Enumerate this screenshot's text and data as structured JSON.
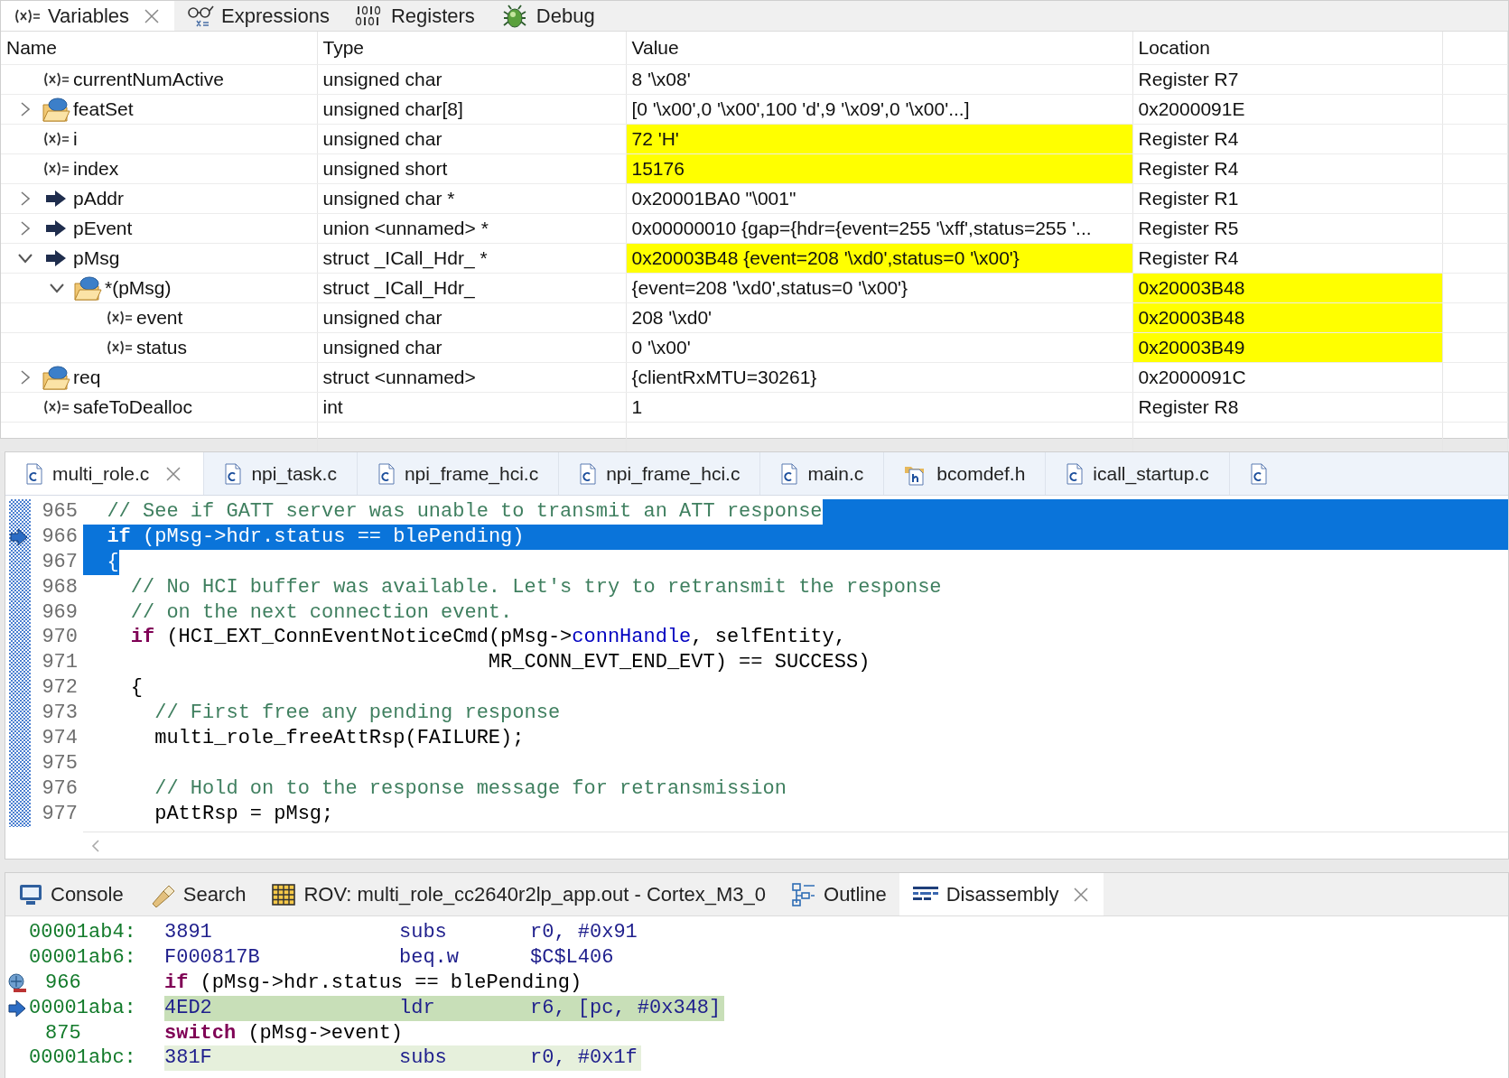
{
  "variables_view": {
    "tabs": [
      {
        "label": "Variables",
        "kind": "variable",
        "selected": true,
        "closable": true
      },
      {
        "label": "Expressions",
        "kind": "expressions",
        "selected": false,
        "closable": false
      },
      {
        "label": "Registers",
        "kind": "registers",
        "selected": false,
        "closable": false
      },
      {
        "label": "Debug",
        "kind": "debug",
        "selected": false,
        "closable": false
      }
    ],
    "columns": [
      "Name",
      "Type",
      "Value",
      "Location"
    ],
    "rows": [
      {
        "name": "currentNumActive",
        "kind": "variable",
        "type": "unsigned char",
        "value": "8 '\\x08'",
        "location": "Register R7",
        "value_changed": false,
        "location_changed": false
      },
      {
        "name": "featSet",
        "kind": "struct",
        "expanded": false,
        "type": "unsigned char[8]",
        "value": "[0 '\\x00',0 '\\x00',100 'd',9 '\\x09',0 '\\x00'...]",
        "location": "0x2000091E",
        "value_changed": false,
        "location_changed": false
      },
      {
        "name": "i",
        "kind": "variable",
        "type": "unsigned char",
        "value": "72 'H'",
        "location": "Register R4",
        "value_changed": true,
        "location_changed": false
      },
      {
        "name": "index",
        "kind": "variable",
        "type": "unsigned short",
        "value": "15176",
        "location": "Register R4",
        "value_changed": true,
        "location_changed": false
      },
      {
        "name": "pAddr",
        "kind": "pointer",
        "expanded": false,
        "type": "unsigned char *",
        "value": "0x20001BA0 \"\\001\"",
        "location": "Register R1",
        "value_changed": false,
        "location_changed": false
      },
      {
        "name": "pEvent",
        "kind": "pointer",
        "expanded": false,
        "type": "union <unnamed> *",
        "value": "0x00000010 {gap={hdr={event=255 '\\xff',status=255 '...",
        "location": "Register R5",
        "value_changed": false,
        "location_changed": false
      },
      {
        "name": "pMsg",
        "kind": "pointer",
        "expanded": true,
        "type": "struct _ICall_Hdr_ *",
        "value": "0x20003B48 {event=208 '\\xd0',status=0 '\\x00'}",
        "location": "Register R4",
        "value_changed": true,
        "location_changed": false,
        "children": [
          {
            "name": "*(pMsg)",
            "kind": "struct",
            "expanded": true,
            "type": "struct _ICall_Hdr_",
            "value": "{event=208 '\\xd0',status=0 '\\x00'}",
            "location": "0x20003B48",
            "value_changed": false,
            "location_changed": true,
            "children": [
              {
                "name": "event",
                "kind": "variable",
                "type": "unsigned char",
                "value": "208 '\\xd0'",
                "location": "0x20003B48",
                "value_changed": false,
                "location_changed": true
              },
              {
                "name": "status",
                "kind": "variable",
                "type": "unsigned char",
                "value": "0 '\\x00'",
                "location": "0x20003B49",
                "value_changed": false,
                "location_changed": true
              }
            ]
          }
        ]
      },
      {
        "name": "req",
        "kind": "struct",
        "expanded": false,
        "type": "struct <unnamed>",
        "value": "{clientRxMTU=30261}",
        "location": "0x2000091C",
        "value_changed": false,
        "location_changed": false
      },
      {
        "name": "safeToDealloc",
        "kind": "variable",
        "type": "int",
        "value": "1",
        "location": "Register R8",
        "value_changed": false,
        "location_changed": false
      }
    ]
  },
  "editor": {
    "tabs": [
      {
        "label": "multi_role.c",
        "kind": "c",
        "selected": true,
        "closable": true
      },
      {
        "label": "npi_task.c",
        "kind": "c",
        "selected": false,
        "closable": false
      },
      {
        "label": "npi_frame_hci.c",
        "kind": "c",
        "selected": false,
        "closable": false
      },
      {
        "label": "npi_frame_hci.c",
        "kind": "c",
        "selected": false,
        "closable": false
      },
      {
        "label": "main.c",
        "kind": "c",
        "selected": false,
        "closable": false
      },
      {
        "label": "bcomdef.h",
        "kind": "h",
        "selected": false,
        "closable": false
      },
      {
        "label": "icall_startup.c",
        "kind": "c",
        "selected": false,
        "closable": false
      }
    ],
    "lines": [
      {
        "number": "965",
        "selected": true,
        "current": false,
        "tokens": [
          {
            "kind": "comment",
            "text": "  // See if GATT server was unable to transmit an ATT response"
          }
        ]
      },
      {
        "number": "966",
        "selected": true,
        "current": true,
        "tokens": [
          {
            "kind": "keyword",
            "text": "  if"
          },
          {
            "kind": "plain",
            "text": " (pMsg->hdr.status == blePending)"
          }
        ]
      },
      {
        "number": "967",
        "selected": true,
        "current": false,
        "tokens": [
          {
            "kind": "plain",
            "text": "  {"
          }
        ]
      },
      {
        "number": "968",
        "selected": false,
        "current": false,
        "tokens": [
          {
            "kind": "comment",
            "text": "    // No HCI buffer was available. Let's try to retransmit the response"
          }
        ]
      },
      {
        "number": "969",
        "selected": false,
        "current": false,
        "tokens": [
          {
            "kind": "comment",
            "text": "    // on the next connection event."
          }
        ]
      },
      {
        "number": "970",
        "selected": false,
        "current": false,
        "tokens": [
          {
            "kind": "keyword",
            "text": "    if"
          },
          {
            "kind": "plain",
            "text": " (HCI_EXT_ConnEventNoticeCmd(pMsg->"
          },
          {
            "kind": "field",
            "text": "connHandle"
          },
          {
            "kind": "plain",
            "text": ", selfEntity,"
          }
        ]
      },
      {
        "number": "971",
        "selected": false,
        "current": false,
        "tokens": [
          {
            "kind": "plain",
            "text": "                                  MR_CONN_EVT_END_EVT) == SUCCESS)"
          }
        ]
      },
      {
        "number": "972",
        "selected": false,
        "current": false,
        "tokens": [
          {
            "kind": "plain",
            "text": "    {"
          }
        ]
      },
      {
        "number": "973",
        "selected": false,
        "current": false,
        "tokens": [
          {
            "kind": "comment",
            "text": "      // First free any pending response"
          }
        ]
      },
      {
        "number": "974",
        "selected": false,
        "current": false,
        "tokens": [
          {
            "kind": "plain",
            "text": "      multi_role_freeAttRsp(FAILURE);"
          }
        ]
      },
      {
        "number": "975",
        "selected": false,
        "current": false
      },
      {
        "number": "976",
        "selected": false,
        "current": false,
        "tokens": [
          {
            "kind": "comment",
            "text": "      // Hold on to the response message for retransmission"
          }
        ]
      },
      {
        "number": "977",
        "selected": false,
        "current": false,
        "tokens": [
          {
            "kind": "plain",
            "text": "      pAttRsp = pMsg;"
          }
        ]
      }
    ]
  },
  "bottom_view": {
    "tabs": [
      {
        "label": "Console",
        "kind": "console",
        "selected": false,
        "closable": false
      },
      {
        "label": "Search",
        "kind": "search",
        "selected": false,
        "closable": false
      },
      {
        "label": "ROV: multi_role_cc2640r2lp_app.out - Cortex_M3_0",
        "kind": "rov",
        "selected": false,
        "closable": false
      },
      {
        "label": "Outline",
        "kind": "outline",
        "selected": false,
        "closable": false
      },
      {
        "label": "Disassembly",
        "kind": "disassembly",
        "selected": true,
        "closable": true
      }
    ],
    "lines": [
      {
        "kind": "asm",
        "address": "00001ab4:",
        "opcode": "3891",
        "mnemonic": "subs",
        "operands": "r0, #0x91",
        "current": false,
        "highlighted": false
      },
      {
        "kind": "asm",
        "address": "00001ab6:",
        "opcode": "F000817B",
        "mnemonic": "beq.w",
        "operands": "$C$L406",
        "current": false,
        "highlighted": false
      },
      {
        "kind": "source",
        "number": "966",
        "keyword": "if",
        "code": " (pMsg->hdr.status == blePending)",
        "breakpoint": true
      },
      {
        "kind": "asm",
        "address": "00001aba:",
        "opcode": "4ED2",
        "mnemonic": "ldr",
        "operands": "r6, [pc, #0x348]",
        "current": true,
        "highlighted": false
      },
      {
        "kind": "source",
        "number": "875",
        "keyword": "switch",
        "code": " (pMsg->event)",
        "breakpoint": false
      },
      {
        "kind": "asm",
        "address": "00001abc:",
        "opcode": "381F",
        "mnemonic": "subs",
        "operands": "r0, #0x1f",
        "current": false,
        "highlighted": true
      }
    ]
  }
}
